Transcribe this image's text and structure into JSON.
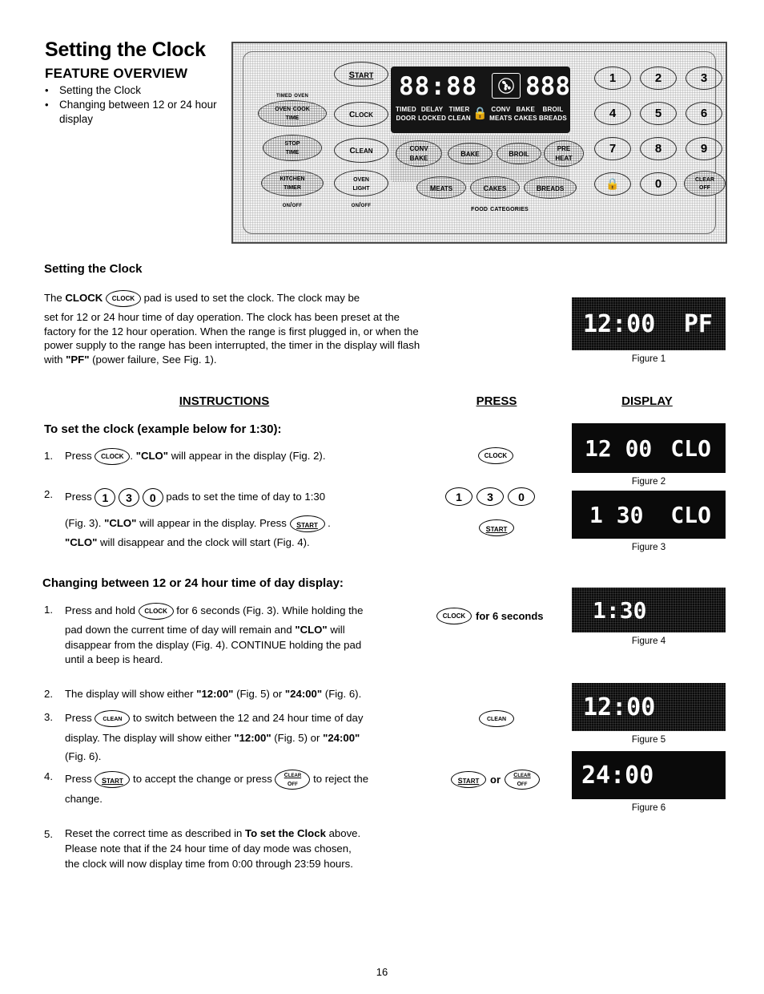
{
  "page": {
    "title": "Setting the Clock",
    "number": "16"
  },
  "feature_overview": {
    "heading": "FEATURE OVERVIEW",
    "items": [
      "Setting the Clock",
      "Changing between 12 or 24 hour display"
    ]
  },
  "control_panel": {
    "timed_oven_label": "Timed Oven",
    "food_categories_label": "Food Categories",
    "pads": {
      "start": "Start",
      "clock": "Clock",
      "clean": "Clean",
      "oven_cook_time_line1": "Oven Cook",
      "oven_cook_time_line2": "Time",
      "stop_time_line1": "Stop",
      "stop_time_line2": "Time",
      "kitchen_timer_line1": "Kitchen",
      "kitchen_timer_line2": "Timer",
      "oven_light_line1": "Oven",
      "oven_light_line2": "Light",
      "onoff_left": "On/Off",
      "onoff_right": "On/Off",
      "conv_bake_line1": "Conv",
      "conv_bake_line2": "Bake",
      "bake": "Bake",
      "broil": "Broil",
      "preheat_line1": "Pre",
      "preheat_line2": "Heat",
      "meats": "Meats",
      "cakes": "Cakes",
      "breads": "Breads",
      "clear_off_line1": "Clear",
      "clear_off_line2": "Off",
      "lock": "lock-icon"
    },
    "keypad": [
      "1",
      "2",
      "3",
      "4",
      "5",
      "6",
      "7",
      "8",
      "9",
      "0"
    ],
    "display": {
      "digits_left": "88:88",
      "digits_right": "888",
      "fan_icon": "convection-fan-icon",
      "indicators": [
        {
          "top": "TIMED",
          "bottom": "DOOR"
        },
        {
          "top": "DELAY",
          "bottom": "LOCKED"
        },
        {
          "top": "TIMER",
          "bottom": "CLEAN"
        },
        {
          "top": "",
          "bottom": "lock-icon"
        },
        {
          "top": "CONV",
          "bottom": "MEATS"
        },
        {
          "top": "BAKE",
          "bottom": "CAKES"
        },
        {
          "top": "BROIL",
          "bottom": "BREADS"
        }
      ]
    }
  },
  "setting_clock": {
    "heading": "Setting the Clock",
    "para_part1": "The ",
    "para_bold_clock": "CLOCK",
    "pad_label": "Clock",
    "para_part2": " pad is used to set the clock. The clock may be",
    "para_rest": "set for 12 or 24 hour time of day operation.  The clock has been preset at the factory for the 12 hour operation.  When the range is first plugged in, or when the power supply to the range has been interrupted, the timer in the display will flash with ",
    "para_bold_pf": "\"PF\"",
    "para_tail": " (power failure, See Fig. 1)."
  },
  "columns": {
    "instructions": "INSTRUCTIONS",
    "press": "PRESS",
    "display": "DISPLAY"
  },
  "set_clock_section": {
    "heading": "To set the clock (example below for 1:30):",
    "steps": [
      {
        "num": "1.",
        "pre": "Press ",
        "pad": "Clock",
        "post_a": ".  ",
        "bold_a": "\"CLO\"",
        "post_b": " will appear in the display (Fig. 2)."
      },
      {
        "num": "2.",
        "pre": "Press ",
        "keys": [
          "1",
          "3",
          "0"
        ],
        "post_a": " pads to set the time of day to 1:30",
        "line2_pre": "(Fig. 3). ",
        "line2_bold": "\"CLO\"",
        "line2_mid": " will appear in the display.  Press ",
        "line2_pad": "Start",
        "line2_post": " .",
        "line3_bold": "\"CLO\"",
        "line3_text": " will disappear and the clock will start (Fig. 4)."
      }
    ]
  },
  "changing_section": {
    "heading": "Changing between 12 or 24 hour time of day display:",
    "steps": [
      {
        "num": "1.",
        "pre": "Press and hold ",
        "pad": "Clock",
        "post_a": " for 6 seconds (Fig. 3). While holding the",
        "line2_a": "pad down the current time of day will remain and ",
        "line2_bold": "\"CLO\"",
        "line2_b": " will",
        "line3": "disappear from the display (Fig. 4). CONTINUE holding the pad",
        "line4": "until a beep is heard."
      },
      {
        "num": "2.",
        "pre": "The display will show either ",
        "bold_a": "\"12:00\"",
        "mid": " (Fig. 5) or ",
        "bold_b": "\"24:00\"",
        "post": " (Fig. 6)."
      },
      {
        "num": "3.",
        "pre": "Press ",
        "pad": "Clean",
        "post_a": " to switch between the 12 and 24 hour time of day",
        "line2_a": "display. The display will show either ",
        "line2_bold_a": "\"12:00\"",
        "line2_mid": " (Fig. 5) or ",
        "line2_bold_b": "\"24:00\"",
        "line3": "(Fig. 6)."
      },
      {
        "num": "4.",
        "pre": "Press ",
        "pad_start": "Start",
        "mid": " to accept the change or press ",
        "pad_clear_line1": "Clear",
        "pad_clear_line2": "Off",
        "post": " to reject the",
        "line2": "change."
      },
      {
        "num": "5.",
        "pre": "Reset the correct time as described in ",
        "bold": "To set the Clock",
        "post": " above.",
        "line2": "Please note that if the 24 hour time of day mode was chosen,",
        "line3": "the clock will now display time from 0:00 through 23:59 hours."
      }
    ]
  },
  "press_column": {
    "items": [
      {
        "type": "pad",
        "label": "Clock"
      },
      {
        "type": "keys",
        "labels": [
          "1",
          "3",
          "0"
        ]
      },
      {
        "type": "pad",
        "label": "Start"
      },
      {
        "type": "pad_with_text",
        "label": "Clock",
        "text": "for 6 seconds"
      },
      {
        "type": "pad",
        "label": "Clean"
      },
      {
        "type": "pad_or_pad",
        "label_a": "Start",
        "connector": "or",
        "label_b_line1": "Clear",
        "label_b_line2": "Off"
      }
    ]
  },
  "figures": [
    {
      "id": "figure-1",
      "value": "12:00",
      "value_right": "PF",
      "caption": "Figure 1",
      "dither": true
    },
    {
      "id": "figure-2",
      "value": "12 00",
      "value_right": "CLO",
      "caption": "Figure 2",
      "dither": false
    },
    {
      "id": "figure-3",
      "value": "1 30",
      "value_right": "CLO",
      "caption": "Figure 3",
      "dither": false
    },
    {
      "id": "figure-4",
      "value": "1:30",
      "value_right": "",
      "caption": "Figure 4",
      "dither": true
    },
    {
      "id": "figure-5",
      "value": "12:00",
      "value_right": "",
      "caption": "Figure 5",
      "dither": true
    },
    {
      "id": "figure-6",
      "value": "24:00",
      "value_right": "",
      "caption": "Figure 6",
      "dither": false
    }
  ]
}
